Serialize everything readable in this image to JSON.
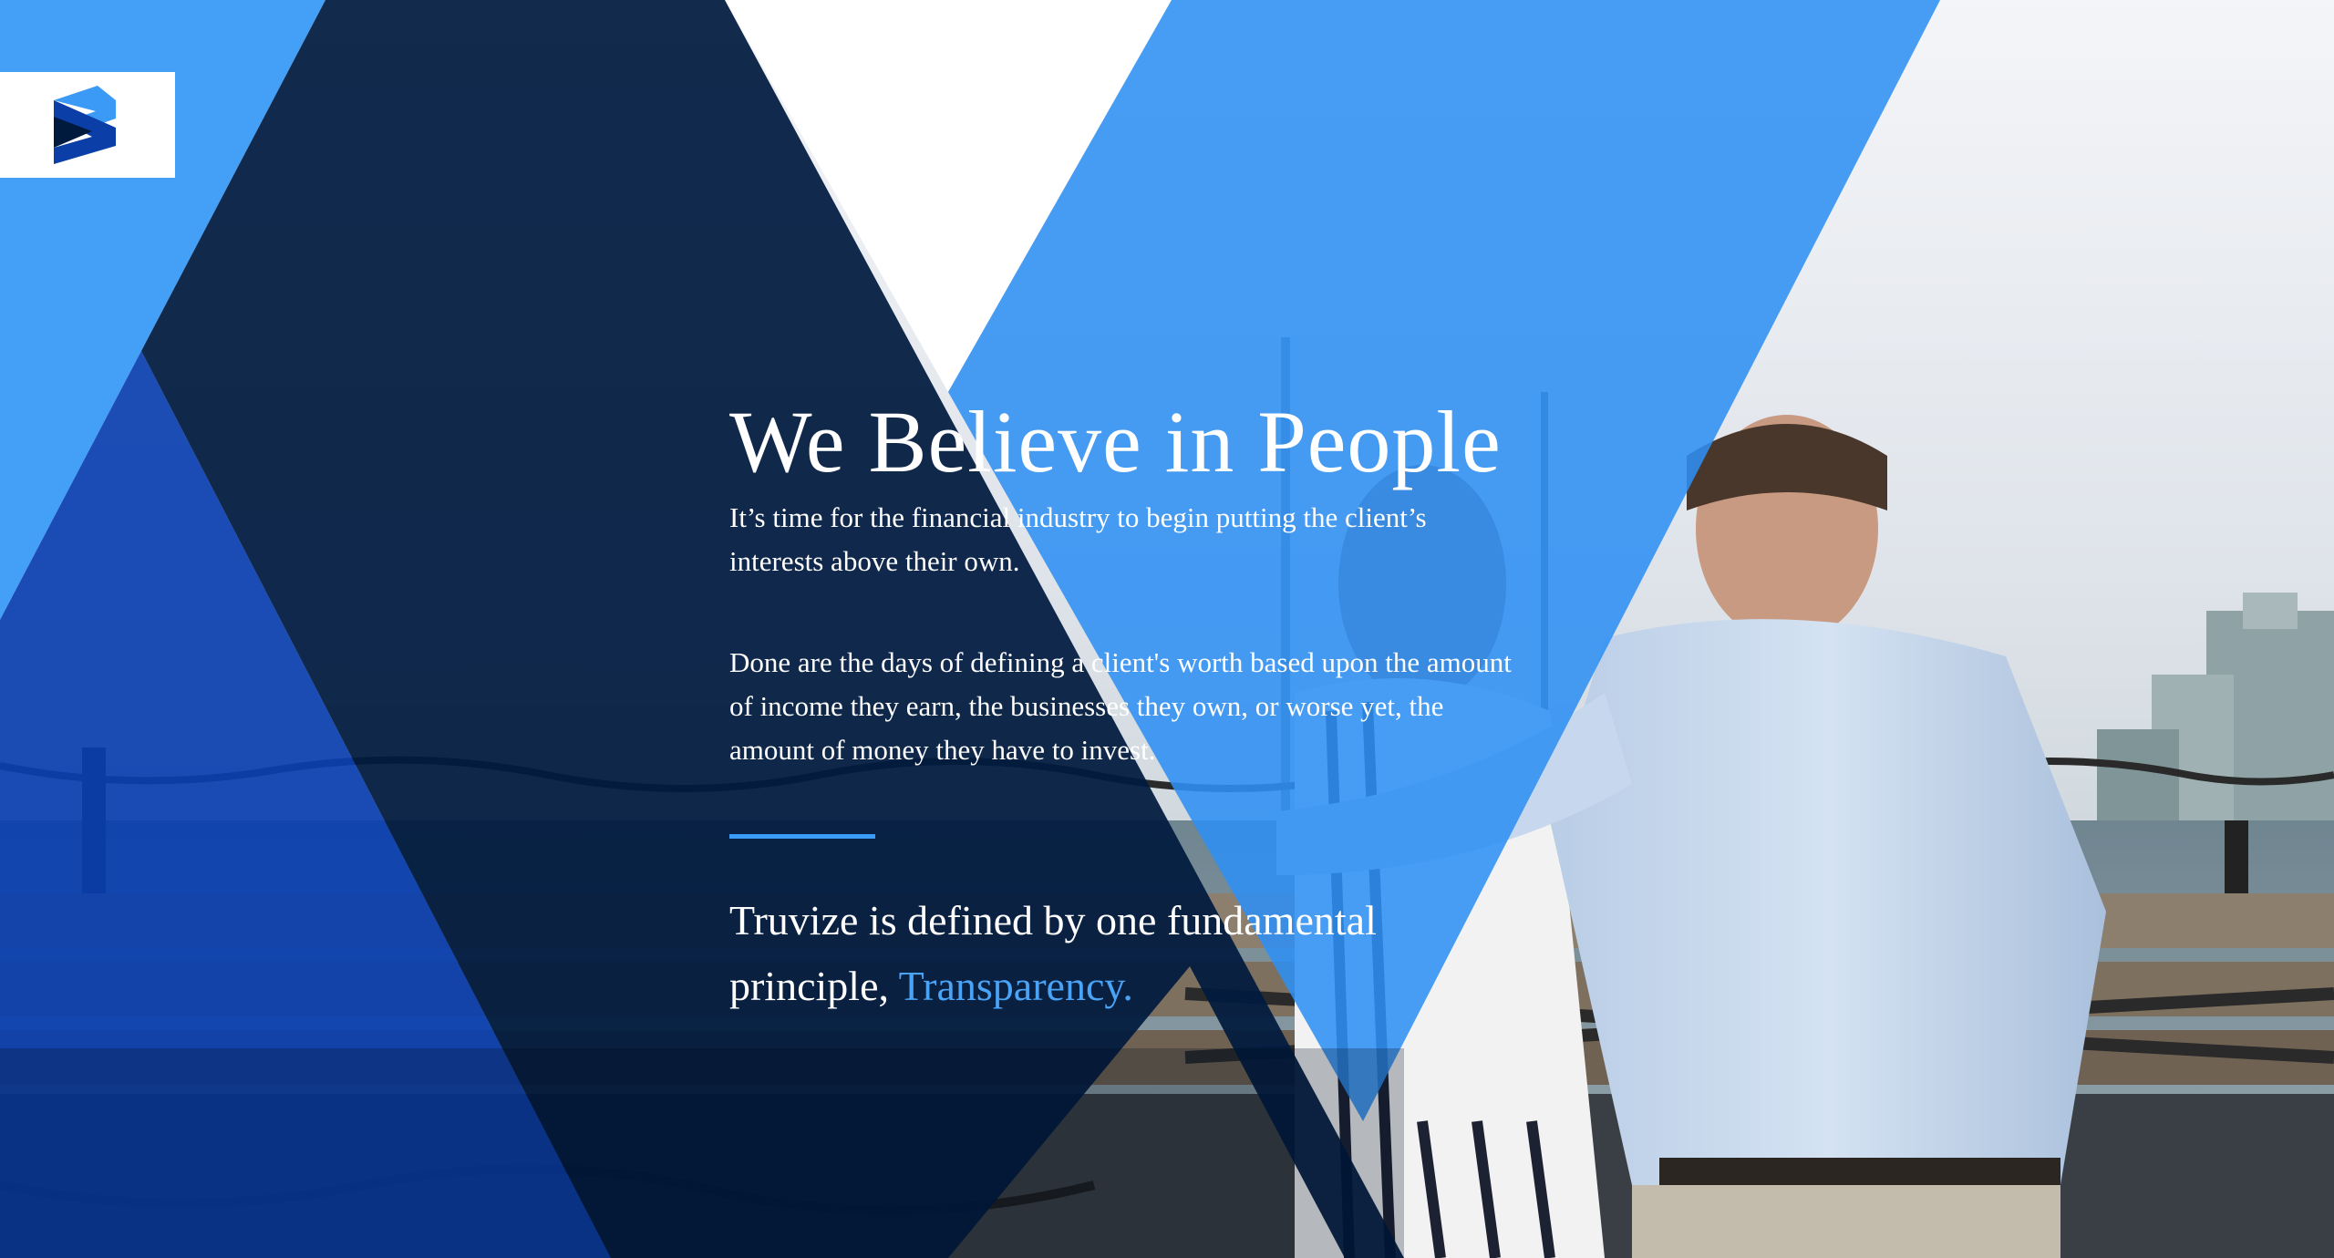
{
  "brand": {
    "logo_icon": "truvize-chevron-logo-icon",
    "colors": {
      "navy": "#001a3e",
      "royal": "#0f4ab5",
      "sky": "#3b9cf7",
      "white": "#ffffff"
    }
  },
  "hero": {
    "title": "We Believe in People",
    "paragraph_1": "It’s time for the financial industry to begin putting the client’s interests above their own.",
    "paragraph_2": "Done are the days of defining a client's worth based upon the amount of income they earn, the businesses they own, or worse yet, the amount of money they have to invest.",
    "tagline_prefix": "Truvize is defined by one fundamental principle,",
    "tagline_accent": "Transparency."
  }
}
